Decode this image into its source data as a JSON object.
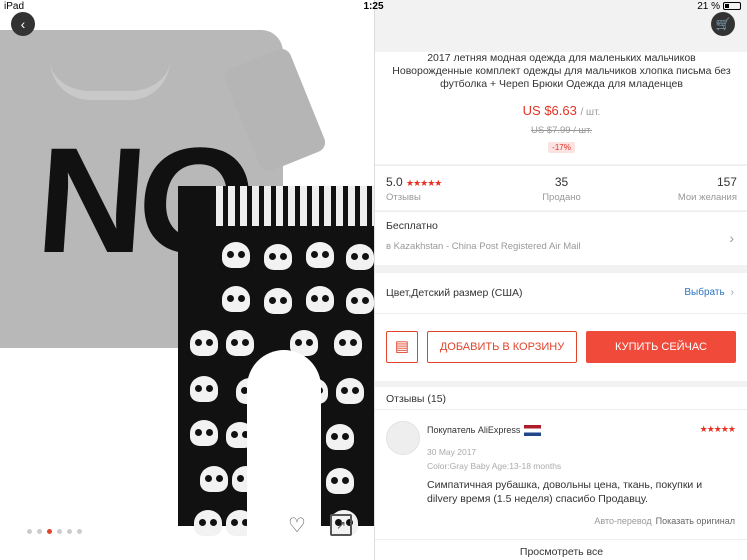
{
  "status": {
    "device": "iPad",
    "time": "1:25",
    "battery": "21 %"
  },
  "nav": {
    "back_icon": "‹",
    "cart_icon": "🛒"
  },
  "gallery": {
    "total": 6,
    "active": 3,
    "heart_icon": "♡",
    "share_icon": "↗"
  },
  "product": {
    "title": "2017 летняя модная одежда для маленьких мальчиков Новорожденные комплект одежды для мальчиков хлопка письма без футболка + Череп Брюки Одежда для младенцев",
    "price": "US $6.63",
    "price_unit": "/ шт.",
    "old_price": "US $7.99 / шт.",
    "discount": "-17%"
  },
  "stats": [
    {
      "value": "5.0",
      "label": "Отзывы",
      "stars": "★★★★★"
    },
    {
      "value": "35",
      "label": "Продано"
    },
    {
      "value": "157",
      "label": "Мои желания"
    }
  ],
  "shipping": {
    "title": "Бесплатно",
    "detail": "в Kazakhstan - China Post Registered Air Mail",
    "chevron": "›"
  },
  "options": {
    "label": "Цвет,Детский размер (США)",
    "action": "Выбрать",
    "chevron": "›"
  },
  "actions": {
    "store_icon": "▤",
    "add_to_cart": "ДОБАВИТЬ В КОРЗИНУ",
    "buy_now": "КУПИТЬ СЕЙЧАС"
  },
  "reviews": {
    "header": "Отзывы (15)",
    "item": {
      "author": "Покупатель AliExpress",
      "stars": "★★★★★",
      "date": "30 May 2017",
      "attrs": "Color:Gray Baby Age:13-18 months",
      "text": "Симпатичная рубашка, довольны цена, ткань, покупки и dilvery время (1.5 неделя) спасибо Продавцу.",
      "auto_translate": "Авто-перевод",
      "show_original": "Показать оригинал"
    },
    "see_all": "Просмотреть все"
  },
  "colors": {
    "accent": "#e43225",
    "buy": "#f04a3a",
    "link": "#2f74c0"
  }
}
